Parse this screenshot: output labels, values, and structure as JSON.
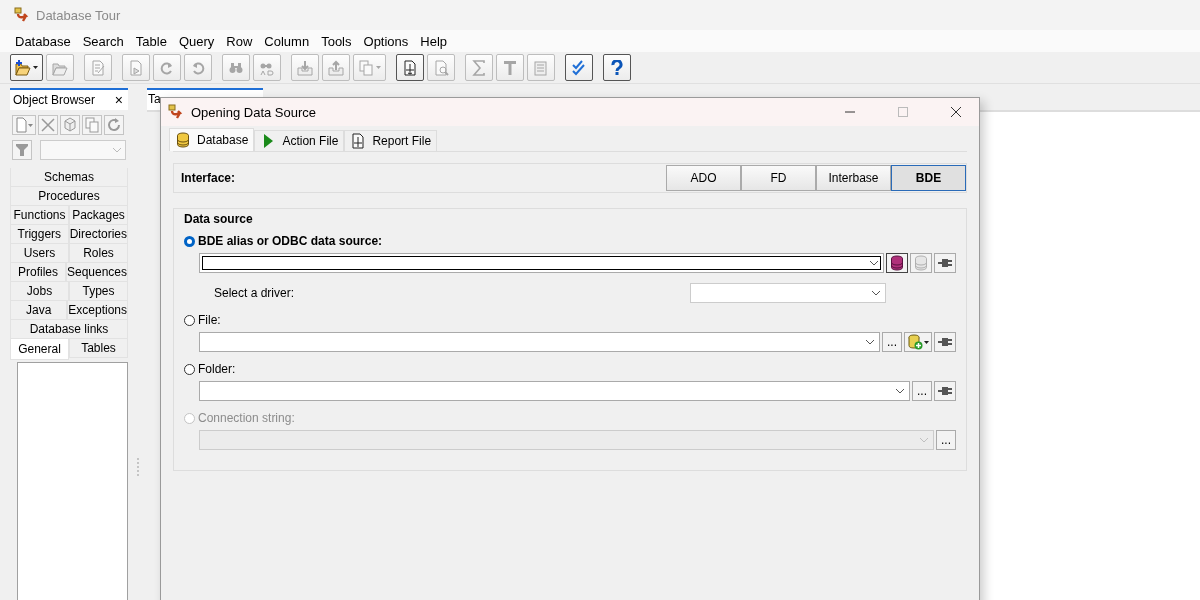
{
  "window": {
    "title": "Database Tour"
  },
  "menu": [
    {
      "label": "Database"
    },
    {
      "label": "Search"
    },
    {
      "label": "Table"
    },
    {
      "label": "Query"
    },
    {
      "label": "Row"
    },
    {
      "label": "Column"
    },
    {
      "label": "Tools"
    },
    {
      "label": "Options"
    },
    {
      "label": "Help"
    }
  ],
  "toolbar": [
    [
      {
        "disabled": false,
        "dropdown": true
      },
      {
        "disabled": true,
        "dropdown": false
      }
    ],
    [
      {
        "disabled": true,
        "dropdown": false
      }
    ],
    [
      {
        "disabled": true,
        "dropdown": false
      },
      {
        "disabled": true,
        "dropdown": false
      },
      {
        "disabled": true,
        "dropdown": false
      }
    ],
    [
      {
        "disabled": true,
        "dropdown": false
      },
      {
        "disabled": true,
        "dropdown": false
      }
    ],
    [
      {
        "disabled": true,
        "dropdown": false
      },
      {
        "disabled": true,
        "dropdown": false
      },
      {
        "disabled": true,
        "dropdown": true
      }
    ],
    [
      {
        "disabled": false,
        "dropdown": false
      },
      {
        "disabled": true,
        "dropdown": false
      }
    ],
    [
      {
        "disabled": true,
        "dropdown": false
      },
      {
        "disabled": true,
        "dropdown": false
      },
      {
        "disabled": true,
        "dropdown": false
      }
    ],
    [
      {
        "disabled": false,
        "dropdown": false
      }
    ],
    [
      {
        "disabled": false,
        "dropdown": false
      }
    ]
  ],
  "object_browser": {
    "title": "Object Browser",
    "close": "×",
    "tabs": [
      [
        {
          "label": "Schemas",
          "selected": false
        }
      ],
      [
        {
          "label": "Procedures",
          "selected": false
        }
      ],
      [
        {
          "label": "Functions",
          "selected": false
        },
        {
          "label": "Packages",
          "selected": false
        }
      ],
      [
        {
          "label": "Triggers",
          "selected": false
        },
        {
          "label": "Directories",
          "selected": false
        }
      ],
      [
        {
          "label": "Users",
          "selected": false
        },
        {
          "label": "Roles",
          "selected": false
        }
      ],
      [
        {
          "label": "Profiles",
          "selected": false
        },
        {
          "label": "Sequences",
          "selected": false
        }
      ],
      [
        {
          "label": "Jobs",
          "selected": false
        },
        {
          "label": "Types",
          "selected": false
        }
      ],
      [
        {
          "label": "Java",
          "selected": false
        },
        {
          "label": "Exceptions",
          "selected": false
        }
      ],
      [
        {
          "label": "Database links",
          "selected": false
        }
      ]
    ],
    "bottom_tabs": [
      {
        "label": "General",
        "selected": true
      },
      {
        "label": "Tables",
        "selected": false
      }
    ]
  },
  "tasks_panel": {
    "tab": "Ta"
  },
  "dialog": {
    "title": "Opening Data Source",
    "tabs": [
      {
        "label": "Database",
        "kind": "database",
        "selected": true
      },
      {
        "label": "Action File",
        "kind": "play",
        "selected": false
      },
      {
        "label": "Report File",
        "kind": "report",
        "selected": false
      }
    ],
    "interface": {
      "label": "Interface:",
      "options": [
        {
          "label": "ADO",
          "selected": false
        },
        {
          "label": "FD",
          "selected": false
        },
        {
          "label": "Interbase",
          "selected": false
        },
        {
          "label": "BDE",
          "selected": true
        }
      ]
    },
    "data_source": {
      "legend": "Data source",
      "sources": [
        {
          "label": "BDE alias or ODBC data source:",
          "selected": true,
          "disabled": false,
          "focused": true,
          "buttons": [
            {
              "kind": "alias-db"
            },
            {
              "kind": "db-list"
            },
            {
              "kind": "plug"
            }
          ],
          "driver": {
            "label": "Select a driver:"
          }
        },
        {
          "label": "File:",
          "selected": false,
          "disabled": false,
          "focused": false,
          "buttons": [
            {
              "kind": "browse",
              "text": "..."
            },
            {
              "kind": "new-db"
            },
            {
              "kind": "plug"
            }
          ]
        },
        {
          "label": "Folder:",
          "selected": false,
          "disabled": false,
          "focused": false,
          "buttons": [
            {
              "kind": "browse",
              "text": "..."
            },
            {
              "kind": "plug"
            }
          ]
        },
        {
          "label": "Connection string:",
          "selected": false,
          "disabled": true,
          "focused": false,
          "buttons": [
            {
              "kind": "browse",
              "text": "..."
            }
          ]
        }
      ]
    }
  }
}
